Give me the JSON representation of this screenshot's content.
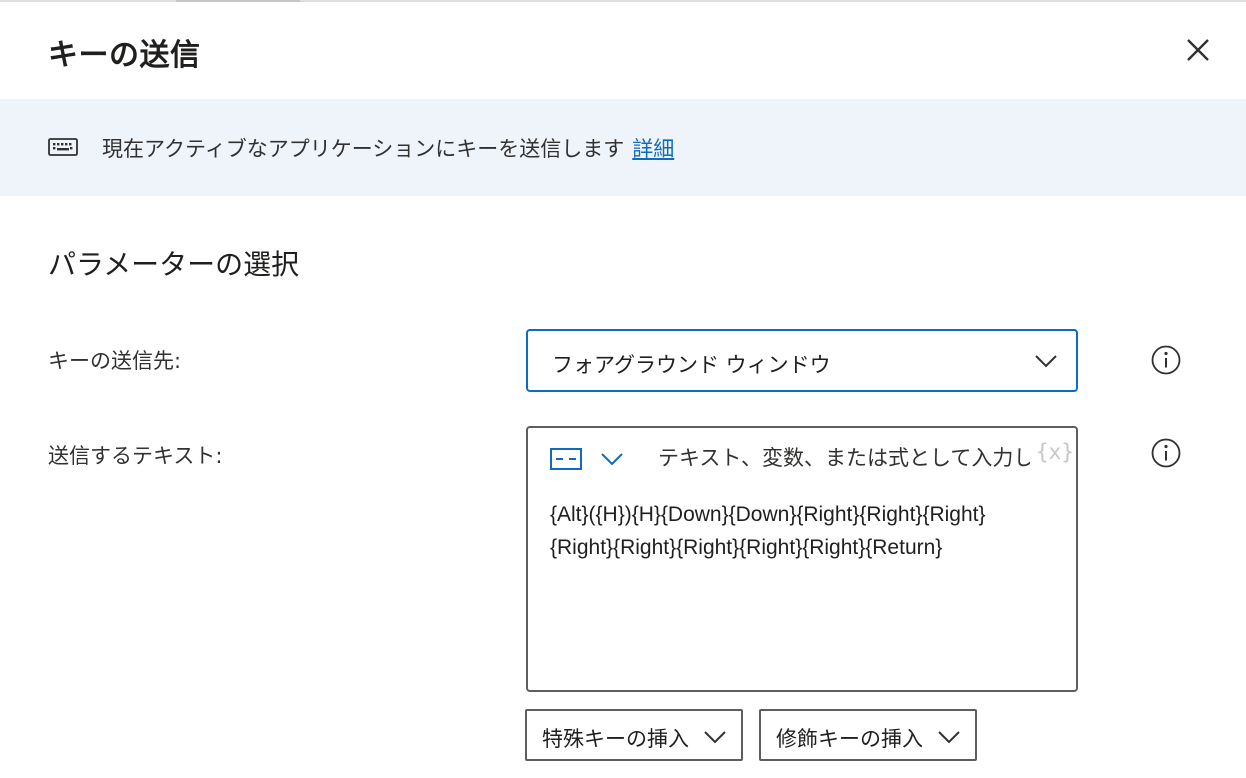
{
  "dialog": {
    "title": "キーの送信",
    "close_icon": "close-icon"
  },
  "banner": {
    "icon": "keyboard-icon",
    "text": "現在アクティブなアプリケーションにキーを送信します",
    "link_label": "詳細"
  },
  "section": {
    "title": "パラメーターの選択"
  },
  "fields": {
    "send_target": {
      "label": "キーの送信先:",
      "value": "フォアグラウンド ウィンドウ",
      "icon": "chevron-down-icon",
      "info_icon": "info-icon"
    },
    "send_text": {
      "label": "送信するテキスト:",
      "type_icon": "text-type-icon",
      "placeholder": "テキスト、変数、または式として入力します",
      "variable_button": "{x}",
      "value_lines": [
        "{Alt}({H}){H}{Down}{Down}{Right}{Right}{Right}",
        "{Right}{Right}{Right}{Right}{Right}{Return}"
      ],
      "info_icon": "info-icon"
    }
  },
  "buttons": {
    "insert_special": "特殊キーの挿入",
    "insert_modifier": "修飾キーの挿入"
  },
  "colors": {
    "accent": "#0f6cbd",
    "banner_bg": "#eff4fb",
    "text": "#323130"
  }
}
